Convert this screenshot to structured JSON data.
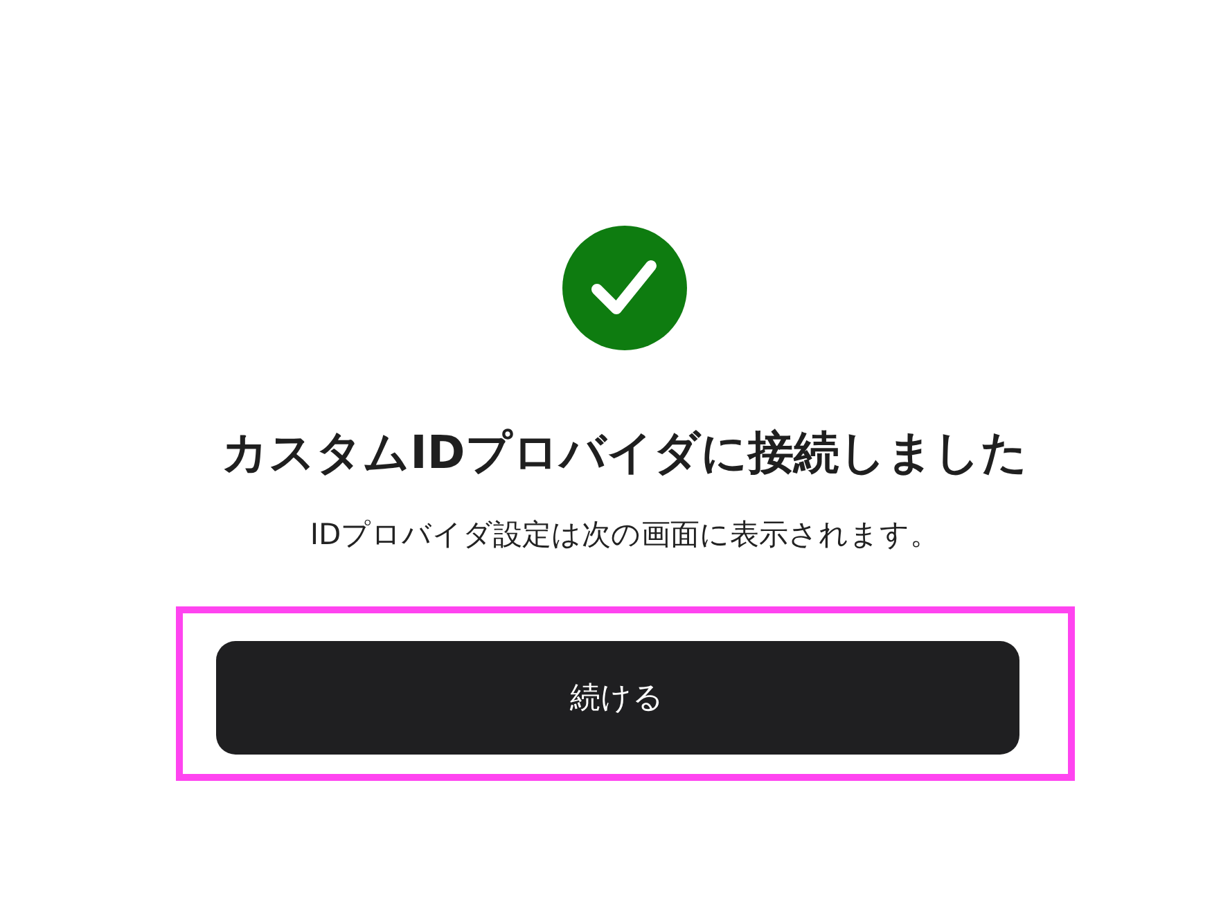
{
  "status": {
    "kind": "success"
  },
  "title": "カスタムIDプロバイダに接続しました",
  "message": "IDプロバイダ設定は次の画面に表示されます。",
  "button": {
    "label": "続ける",
    "highlighted": true
  }
}
